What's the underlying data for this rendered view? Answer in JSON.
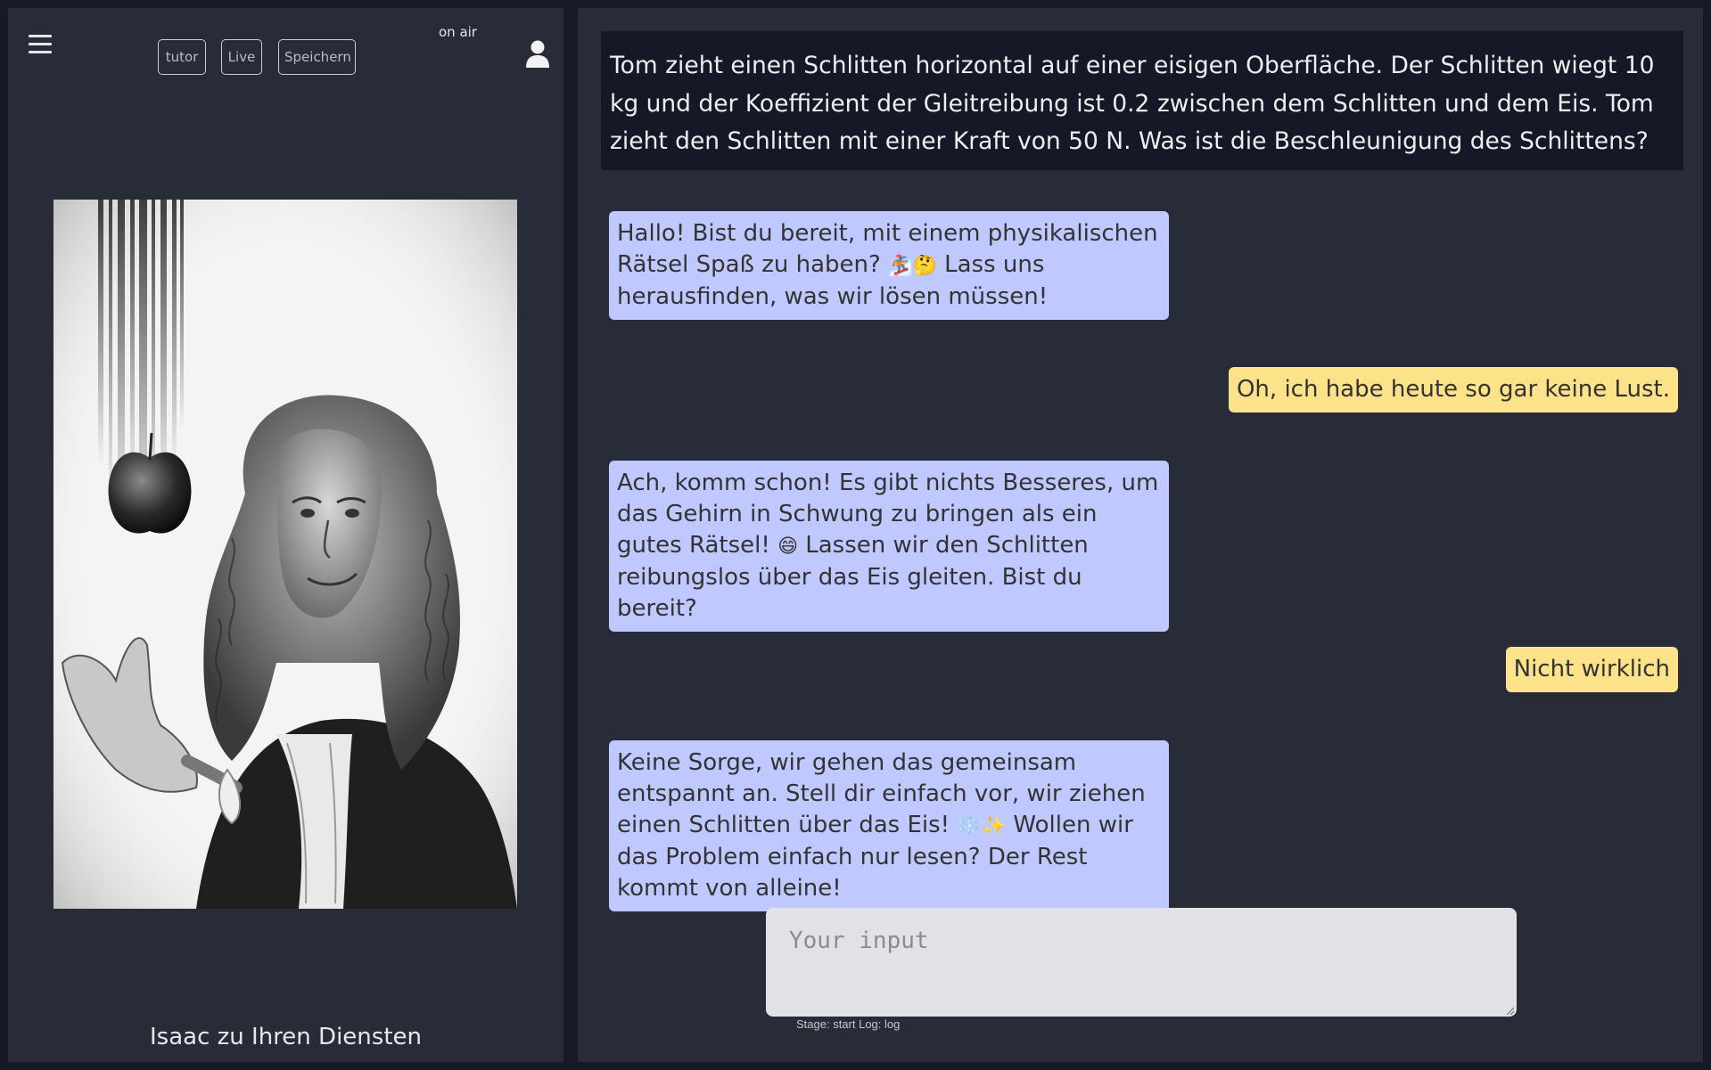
{
  "header": {
    "buttons": [
      "tutor",
      "Live",
      "Speichern"
    ],
    "status": "on air"
  },
  "sidebar": {
    "caption": "Isaac zu Ihren Diensten"
  },
  "task": {
    "question": "Tom zieht einen Schlitten horizontal auf einer eisigen Oberfläche. Der Schlitten wiegt 10 kg und der Koeffizient der Gleitreibung ist 0.2 zwischen dem Schlitten und dem Eis. Tom zieht den Schlitten mit einer Kraft von 50 N. Was ist die Beschleunigung des Schlittens?"
  },
  "chat": {
    "messages": [
      {
        "role": "tutor",
        "text_before": "Hallo! Bist du bereit, mit einem physikalischen Rätsel Spaß zu haben? ",
        "emoji": "🏂🤔",
        "text_after": " Lass uns herausfinden, was wir lösen müssen!"
      },
      {
        "role": "user",
        "text": "Oh, ich habe heute so gar keine Lust."
      },
      {
        "role": "tutor",
        "text_before": "Ach, komm schon! Es gibt nichts Besseres, um das Gehirn in Schwung zu bringen als ein gutes Rätsel! ",
        "emoji": "😄",
        "text_after": " Lassen wir den Schlitten reibungslos über das Eis gleiten. Bist du bereit?"
      },
      {
        "role": "user",
        "text": "Nicht wirklich"
      },
      {
        "role": "tutor",
        "text_before": "Keine Sorge, wir gehen das gemeinsam entspannt an. Stell dir einfach vor, wir ziehen einen Schlitten über das Eis! ",
        "emoji": "❄️✨",
        "text_after": " Wollen wir das Problem einfach nur lesen? Der Rest kommt von alleine!"
      }
    ]
  },
  "input": {
    "placeholder": "Your input",
    "value": ""
  },
  "footer": {
    "stage_text": "Stage: start Log: log"
  }
}
